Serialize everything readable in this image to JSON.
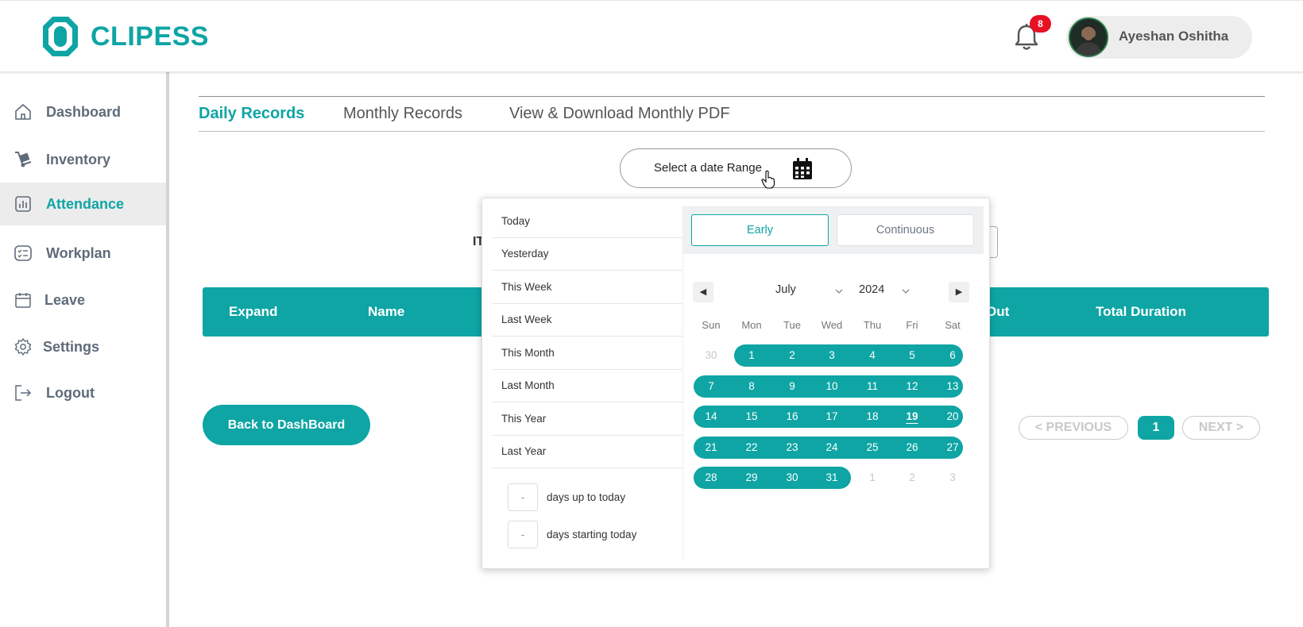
{
  "app": {
    "name": "CLIPESS",
    "brand_color": "#0ea5a4"
  },
  "header": {
    "notifications": {
      "icon": "bell-icon",
      "count": "8"
    },
    "user": {
      "name": "Ayeshan Oshitha",
      "avatar": "avatar-photo"
    }
  },
  "sidebar": {
    "items": [
      {
        "label": "Dashboard",
        "icon": "home-icon"
      },
      {
        "label": "Inventory",
        "icon": "dolly-icon"
      },
      {
        "label": "Attendance",
        "icon": "bar-chart-icon",
        "active": true
      },
      {
        "label": "Workplan",
        "icon": "checklist-icon"
      },
      {
        "label": "Leave",
        "icon": "calendar-icon"
      },
      {
        "label": "Settings",
        "icon": "gear-icon"
      },
      {
        "label": "Logout",
        "icon": "logout-icon"
      }
    ]
  },
  "tabs": [
    {
      "label": "Daily Records",
      "active": true
    },
    {
      "label": "Monthly Records"
    },
    {
      "label": "View & Download Monthly PDF"
    }
  ],
  "date_range_button": {
    "label": "Select a date Range",
    "icon": "calendar-grid-icon"
  },
  "table": {
    "partial_label": "IT",
    "headers": [
      "Expand",
      "Name",
      "Out",
      "Total Duration"
    ]
  },
  "back_button": {
    "label": "Back to DashBoard"
  },
  "pagination": {
    "previous": "< PREVIOUS",
    "current": "1",
    "next": "NEXT >"
  },
  "date_picker": {
    "ranges": [
      "Today",
      "Yesterday",
      "This Week",
      "Last Week",
      "This Month",
      "Last Month",
      "This Year",
      "Last Year"
    ],
    "days_up_to_today": {
      "value": "-",
      "label": "days up to today"
    },
    "days_starting_today": {
      "value": "-",
      "label": "days starting today"
    },
    "modes": {
      "early": "Early",
      "continuous": "Continuous"
    },
    "month": "July",
    "year": "2024",
    "weekdays": [
      "Sun",
      "Mon",
      "Tue",
      "Wed",
      "Thu",
      "Fri",
      "Sat"
    ],
    "weeks": [
      [
        "30",
        "1",
        "2",
        "3",
        "4",
        "5",
        "6"
      ],
      [
        "7",
        "8",
        "9",
        "10",
        "11",
        "12",
        "13"
      ],
      [
        "14",
        "15",
        "16",
        "17",
        "18",
        "19",
        "20"
      ],
      [
        "21",
        "22",
        "23",
        "24",
        "25",
        "26",
        "27"
      ],
      [
        "28",
        "29",
        "30",
        "31",
        "1",
        "2",
        "3"
      ]
    ],
    "today": "19",
    "selected_range": "July 1 - July 31"
  }
}
